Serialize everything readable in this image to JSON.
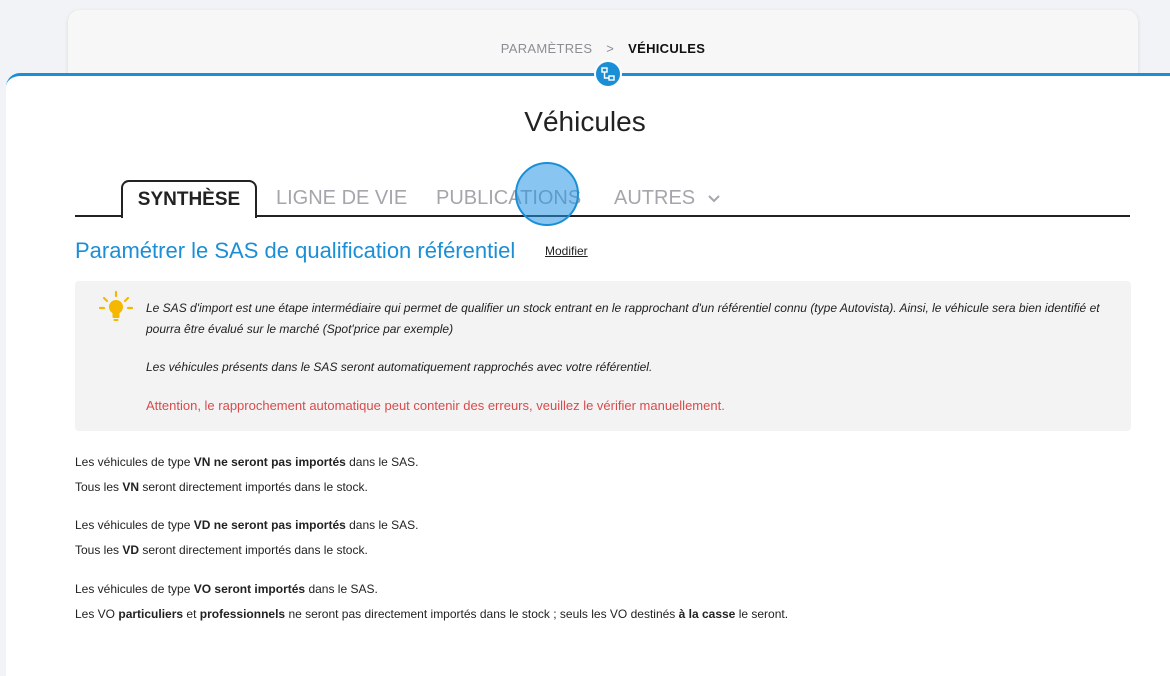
{
  "breadcrumb": {
    "parent": "PARAMÈTRES",
    "separator": ">",
    "current": "VÉHICULES"
  },
  "page": {
    "title": "Véhicules"
  },
  "tabs": [
    {
      "label": "SYNTHÈSE",
      "active": true
    },
    {
      "label": "LIGNE DE VIE",
      "active": false
    },
    {
      "label": "PUBLICATIONS",
      "active": false
    },
    {
      "label": "AUTRES",
      "active": false,
      "has_dropdown": true
    }
  ],
  "section": {
    "title": "Paramétrer le SAS de qualification référentiel",
    "modify_label": "Modifier"
  },
  "info": {
    "icon": "lightbulb-icon",
    "paragraph1": "Le SAS d'import est une étape intermédiaire qui permet de qualifier un stock entrant en le rapprochant d'un référentiel connu (type Autovista). Ainsi, le véhicule sera bien identifié et pourra être évalué sur le marché (Spot'price par exemple)",
    "paragraph2": "Les véhicules présents dans le SAS seront automatiquement rapprochés avec votre référentiel.",
    "warning": "Attention, le rapprochement automatique peut contenir des erreurs, veuillez le vérifier manuellement."
  },
  "rules": {
    "vn": {
      "l1_a": "Les véhicules de type ",
      "l1_b": "VN ne seront pas importés",
      "l1_c": " dans le SAS.",
      "l2_a": "Tous les ",
      "l2_b": "VN",
      "l2_c": " seront directement importés dans le stock."
    },
    "vd": {
      "l1_a": "Les véhicules de type ",
      "l1_b": "VD ne seront pas importés",
      "l1_c": " dans le SAS.",
      "l2_a": "Tous les ",
      "l2_b": "VD",
      "l2_c": " seront directement importés dans le stock."
    },
    "vo": {
      "l1_a": "Les véhicules de type ",
      "l1_b": "VO seront importés",
      "l1_c": " dans le SAS.",
      "l2_a": "Les VO ",
      "l2_b": "particuliers",
      "l2_c": " et ",
      "l2_d": "professionnels",
      "l2_e": " ne seront pas directement importés dans le stock ; seuls les VO destinés ",
      "l2_f": "à la casse",
      "l2_g": " le seront."
    }
  },
  "colors": {
    "accent": "#1b8fd6",
    "warning": "#d94b4b"
  }
}
